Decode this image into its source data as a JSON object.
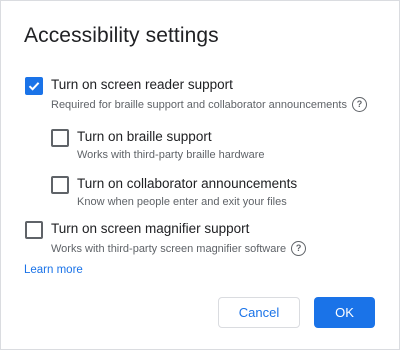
{
  "dialog": {
    "title": "Accessibility settings",
    "options": [
      {
        "label": "Turn on screen reader support",
        "description": "Required for braille support and collaborator announcements",
        "checked": true,
        "help_icon": "help-circle-icon"
      },
      {
        "label": "Turn on braille support",
        "description": "Works with third-party braille hardware",
        "checked": false
      },
      {
        "label": "Turn on collaborator announcements",
        "description": "Know when people enter and exit your files",
        "checked": false
      },
      {
        "label": "Turn on screen magnifier support",
        "description": "Works with third-party screen magnifier software",
        "checked": false,
        "help_icon": "help-circle-icon"
      }
    ],
    "learn_more": "Learn more",
    "cancel_label": "Cancel",
    "ok_label": "OK",
    "accent_color": "#1a73e8"
  }
}
